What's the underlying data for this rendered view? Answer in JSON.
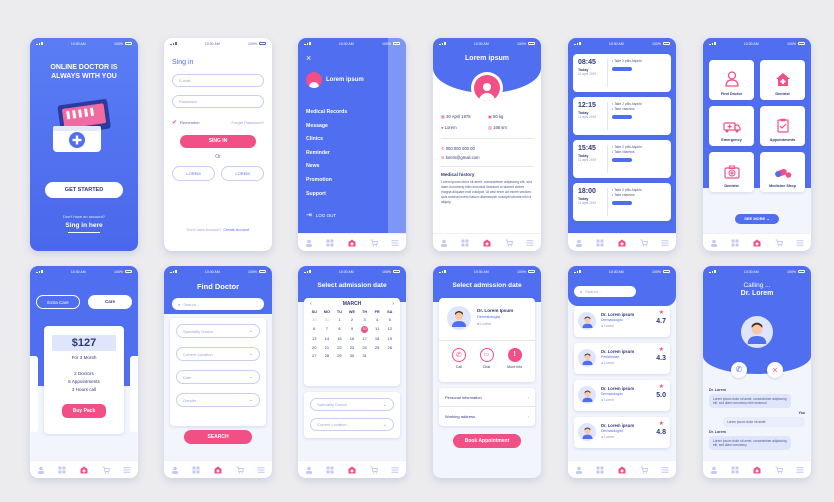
{
  "status": {
    "time": "10:30 AM",
    "battery": "100%"
  },
  "colors": {
    "primary": "#4f6ef0",
    "accent": "#f14f86",
    "bg": "#ececef"
  },
  "s1": {
    "headline_1": "ONLINE DOCTOR IS",
    "headline_2": "ALWAYS WITH YOU",
    "cta": "GET STARTED",
    "no_account": "Don't have an account?",
    "sign_link": "Sing in here"
  },
  "s2": {
    "title": "Sing in",
    "email_ph": "E-mail",
    "password_ph": "Password",
    "remember": "Remember",
    "forgot": "Forget Password?",
    "sign_btn": "SING IN",
    "or": "Or",
    "social_1": "LOREM",
    "social_2": "LOREM",
    "no_account": "Don't have Account?",
    "create": "Create Account"
  },
  "s3": {
    "user": "Lorem ipsum",
    "menu": [
      "Medical Records",
      "Message",
      "Clinics",
      "Reminder",
      "News",
      "Promotion",
      "Support"
    ],
    "logout": "LOG OUT"
  },
  "s4": {
    "name": "Lorem ipsum",
    "dob": "30 April 1978",
    "weight": "50 kg",
    "place": "Lorem",
    "height": "168 sm",
    "phone": "000 000 000 00",
    "email": "lorem@gmail.com",
    "history_title": "Medical history",
    "history_text": "Lorem ipsum dolor sit amet, consectetuer adipiscing elit, sed diam nonummy nibh euismod tincidunt ut laoreet dolore magna aliquam erat volutpat. Ut wisi enim ad minim veniam, quis nostrud exerci tation ullamcorper suscipit lobortis nisl ut aliquip"
  },
  "s5": {
    "reminders": [
      {
        "time": "08:45",
        "day": "Today",
        "date": "11 april 2019",
        "line1": "Take 2 pills Aspirin",
        "line2": ""
      },
      {
        "time": "12:15",
        "day": "Today",
        "date": "11 april 2019",
        "line1": "Take 2 pills Aspirin",
        "line2": "Take vitamins"
      },
      {
        "time": "15:45",
        "day": "Today",
        "date": "11 april 2019",
        "line1": "Take 2 pills Aspirin",
        "line2": "Take vitamins"
      },
      {
        "time": "18:00",
        "day": "Today",
        "date": "11 april 2019",
        "line1": "Take 2 pills Aspirin",
        "line2": "Take vitamins"
      }
    ]
  },
  "s6": {
    "tiles": [
      "Find Doctor",
      "Dentrist",
      "Emergency",
      "Appointments",
      "Dentrist",
      "Medicine Shop"
    ],
    "see_more": "SEE MORE"
  },
  "s7": {
    "tab_1": "Extra Care",
    "tab_2": "Care",
    "price": "$127",
    "period": "For 3 Month",
    "features": [
      "2 Doctors",
      "5 Appointments",
      "3 Hours call"
    ],
    "buy": "Buy Pack"
  },
  "s8": {
    "title": "Find Doctor",
    "search_ph": "Search...",
    "fields": [
      "Speciality Doctor",
      "Current Location",
      "Date",
      "Gender"
    ],
    "search_btn": "SEARCH"
  },
  "s9": {
    "title": "Select admission date",
    "month": "MARCH",
    "weekdays": [
      "SU",
      "MO",
      "TU",
      "WE",
      "TH",
      "FR",
      "SA"
    ],
    "days": [
      "30",
      "31",
      "1",
      "2",
      "3",
      "4",
      "5",
      "6",
      "7",
      "8",
      "9",
      "10",
      "11",
      "12",
      "13",
      "14",
      "15",
      "16",
      "17",
      "18",
      "19",
      "20",
      "21",
      "22",
      "23",
      "24",
      "25",
      "26",
      "27",
      "28",
      "29",
      "30",
      "31"
    ],
    "selected": "10",
    "fields": [
      "Speciality Doctor",
      "Current Location"
    ]
  },
  "s10": {
    "title": "Select admission date",
    "doctor": "Dr. Lorem Ipsum",
    "specialty": "Dermatologist",
    "place": "Lorem",
    "actions": [
      "Call",
      "Chat",
      "More info"
    ],
    "rows": [
      "Personal information",
      "Working address"
    ],
    "book": "Book Appointment"
  },
  "s11": {
    "search_ph": "Search...",
    "doctors": [
      {
        "name": "Dr. Lorem ipsum",
        "spec": "Dermatologist",
        "place": "Lorem",
        "rating": "4.7"
      },
      {
        "name": "Dr. Lorem ipsum",
        "spec": "Pediatrician",
        "place": "Lorem",
        "rating": "4.3"
      },
      {
        "name": "Dr. Lorem ipsum",
        "spec": "Dermatologist",
        "place": "Lorem",
        "rating": "5.0"
      },
      {
        "name": "Dr. Lorem ipsum",
        "spec": "Dermatologist",
        "place": "Lorem",
        "rating": "4.8"
      }
    ]
  },
  "s12": {
    "calling": "Calling ...",
    "name": "Dr. Lorem",
    "msgs": [
      {
        "from": "Dr. Lorem",
        "text": "Lorem ipsum dolor sit amet, consectetuer adipiscing elit, sed diam nonummy nibh euismod"
      },
      {
        "from": "You",
        "text": "Lorem ipsum dolor sit amet"
      },
      {
        "from": "Dr. Lorem",
        "text": "Lorem ipsum dolor sit amet, consectetuer adipiscing elit, sed diam nonummy"
      }
    ]
  }
}
